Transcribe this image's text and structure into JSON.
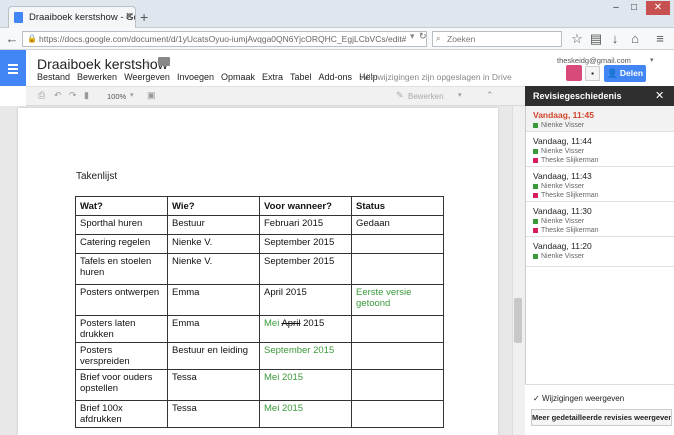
{
  "browser": {
    "tab_title": "Draaiboek kerstshow - Goo...",
    "url": "https://docs.google.com/document/d/1yUcatsOyuo-iumjAvqga0QN6YjcORQHC_EgjLCbVCs/edit#",
    "search_placeholder": "Zoeken"
  },
  "docs": {
    "title": "Draaiboek kerstshow",
    "menu": [
      "Bestand",
      "Bewerken",
      "Weergeven",
      "Invoegen",
      "Opmaak",
      "Extra",
      "Tabel",
      "Add-ons",
      "Help"
    ],
    "save_status": "Alle wijzigingen zijn opgeslagen in Drive",
    "user_email": "theskeidg@gmail.com",
    "share_label": "Delen",
    "zoom": "100%",
    "edit_mode": "Bewerken"
  },
  "document": {
    "heading": "Takenlijst",
    "table": {
      "headers": [
        "Wat?",
        "Wie?",
        "Voor wanneer?",
        "Status"
      ],
      "rows": [
        [
          "Sporthal huren",
          "Bestuur",
          "Februari 2015",
          "Gedaan"
        ],
        [
          "Catering regelen",
          "Nienke V.",
          "September 2015",
          ""
        ],
        [
          "Tafels en stoelen huren",
          "Nienke V.",
          "September 2015",
          ""
        ],
        [
          "Posters ontwerpen",
          "Emma",
          "April 2015",
          "Eerste versie getoond"
        ],
        [
          "Posters laten drukken",
          "Emma",
          "Mei April 2015",
          ""
        ],
        [
          "Posters verspreiden",
          "Bestuur en leiding",
          "September 2015",
          ""
        ],
        [
          "Brief voor ouders opstellen",
          "Tessa",
          "Mei 2015",
          ""
        ],
        [
          "Brief 100x afdrukken",
          "Tessa",
          "Mei 2015",
          ""
        ]
      ]
    }
  },
  "revision_panel": {
    "title": "Revisiegeschiedenis",
    "revisions": [
      {
        "time": "Vandaag, 11:45",
        "current": true,
        "users": [
          "Nienke Visser"
        ]
      },
      {
        "time": "Vandaag, 11:44",
        "current": false,
        "users": [
          "Nienke Visser",
          "Theske Slijkerman"
        ]
      },
      {
        "time": "Vandaag, 11:43",
        "current": false,
        "users": [
          "Nienke Visser",
          "Theske Slijkerman"
        ]
      },
      {
        "time": "Vandaag, 11:30",
        "current": false,
        "users": [
          "Nienke Visser",
          "Theske Slijkerman"
        ]
      },
      {
        "time": "Vandaag, 11:20",
        "current": false,
        "users": [
          "Nienke Visser"
        ]
      }
    ],
    "show_changes_label": "Wijzigingen weergeven",
    "show_changes_checked": true,
    "detail_button": "Meer gedetailleerde revisies weergeven"
  },
  "colors": {
    "docs_blue": "#4285f4",
    "current_revision": "#d0452b",
    "nienke": "#3a9a3a",
    "theske": "#d81b60",
    "suggestion_green": "#3a9a3a"
  }
}
